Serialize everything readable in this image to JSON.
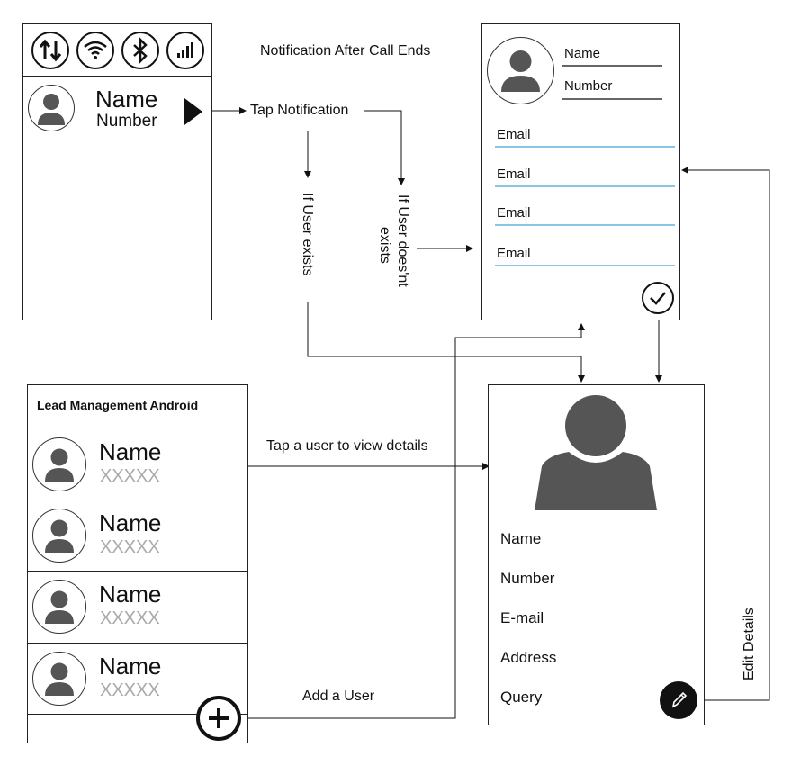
{
  "notification_screen": {
    "status_icons": [
      "data-arrows-icon",
      "wifi-icon",
      "bluetooth-icon",
      "signal-bars-icon"
    ],
    "contact_name": "Name",
    "contact_number": "Number"
  },
  "flow_labels": {
    "notification_after_call": "Notification After Call Ends",
    "tap_notification": "Tap Notification",
    "if_user_exists": "If User exists",
    "if_user_doesnt_exist_1": "If User does'nt",
    "if_user_doesnt_exist_2": "exists",
    "tap_user": "Tap a user to view details",
    "add_user": "Add a User",
    "edit_details": "Edit Details"
  },
  "new_contact_form": {
    "name_label": "Name",
    "number_label": "Number",
    "email_fields": [
      "Email",
      "Email",
      "Email",
      "Email"
    ]
  },
  "lead_list": {
    "title": "Lead Management Android",
    "items": [
      {
        "name": "Name",
        "number": "XXXXX"
      },
      {
        "name": "Name",
        "number": "XXXXX"
      },
      {
        "name": "Name",
        "number": "XXXXX"
      },
      {
        "name": "Name",
        "number": "XXXXX"
      }
    ]
  },
  "details_screen": {
    "fields": [
      "Name",
      "Number",
      "E-mail",
      "Address",
      "Query"
    ]
  },
  "colors": {
    "field_underline": "#8cc4e6",
    "avatar_fill": "#555555",
    "placeholder_text": "#aaaaaa"
  }
}
